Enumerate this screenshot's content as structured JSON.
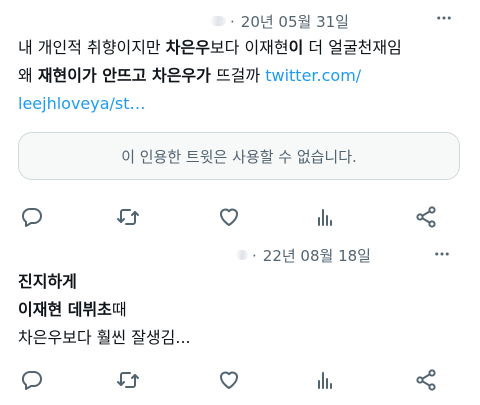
{
  "tweets": [
    {
      "date": "20년 05월 31일",
      "dot": "·",
      "lines": [
        [
          {
            "text": "내 개인적 취향이지만 ",
            "bold": false
          },
          {
            "text": "차은우",
            "bold": true
          },
          {
            "text": "보다 이재현",
            "bold": false
          },
          {
            "text": "이",
            "bold": true
          },
          {
            "text": " 더 얼굴천재임",
            "bold": false
          }
        ],
        [
          {
            "text": "왜 ",
            "bold": false
          },
          {
            "text": "재현이가 안뜨고 차은우가",
            "bold": true
          },
          {
            "text": " 뜨걸까 ",
            "bold": false
          },
          {
            "text": "twitter.com/",
            "bold": false,
            "link": true
          }
        ],
        [
          {
            "text": "leejhloveya/st…",
            "bold": false,
            "link": true
          }
        ]
      ],
      "quote_unavailable": "이 인용한 트윗은 사용할 수 없습니다."
    },
    {
      "date": "22년 08월 18일",
      "dot": "·",
      "lines": [
        [
          {
            "text": "진지하게",
            "bold": true
          }
        ],
        [
          {
            "text": "이재현 데뷔초",
            "bold": true
          },
          {
            "text": "때",
            "bold": false
          }
        ],
        [
          {
            "text": "차은우보다 훨씬 잘생김...",
            "bold": false
          }
        ]
      ]
    }
  ],
  "icons": {
    "more": "more-horizontal-icon",
    "reply": "reply-icon",
    "retweet": "retweet-icon",
    "like": "heart-icon",
    "views": "views-analytics-icon",
    "share": "share-icon"
  },
  "colors": {
    "text": "#0f1419",
    "secondary": "#536471",
    "link": "#1d9bf0",
    "quote_bg": "#f7f9f9",
    "quote_border": "#cfd9de"
  }
}
